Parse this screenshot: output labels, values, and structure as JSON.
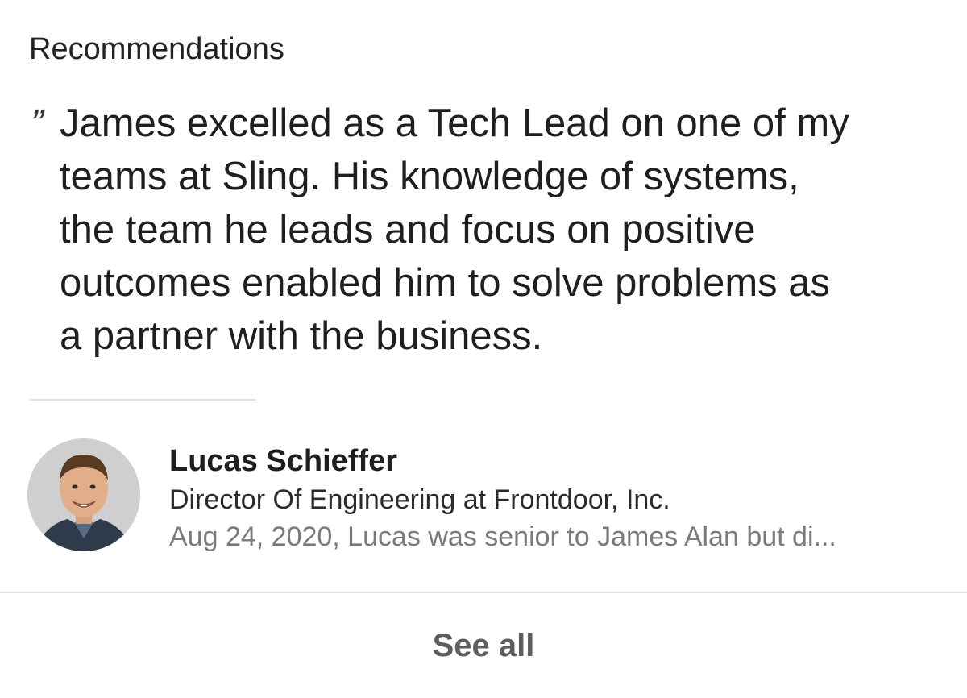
{
  "section": {
    "title": "Recommendations"
  },
  "recommendation": {
    "quote_mark": "”",
    "text": "James excelled as a Tech Lead on one of my\nteams at Sling.  His knowledge of systems,\nthe team he leads and focus on positive\noutcomes enabled him to solve problems as\na partner with the business.",
    "recommender": {
      "name": "Lucas Schieffer",
      "headline": "Director Of Engineering at Frontdoor, Inc.",
      "meta": "Aug 24, 2020, Lucas was senior to James Alan but di..."
    }
  },
  "footer": {
    "see_all_label": "See all"
  },
  "colors": {
    "background": "#ffffff",
    "divider": "#e3e3e3",
    "meta_text": "#7a7a7a",
    "see_all_text": "#5e5e5e"
  }
}
